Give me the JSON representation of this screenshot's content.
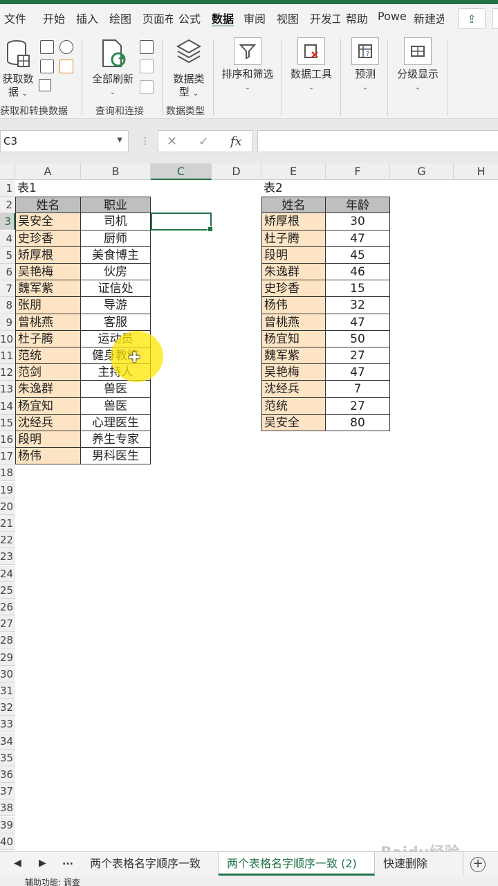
{
  "ribbon_tabs": [
    {
      "label": "文件",
      "active": false
    },
    {
      "label": "开始",
      "active": false
    },
    {
      "label": "插入",
      "active": false
    },
    {
      "label": "绘图",
      "active": false
    },
    {
      "label": "页面布",
      "active": false
    },
    {
      "label": "公式",
      "active": false
    },
    {
      "label": "数据",
      "active": true
    },
    {
      "label": "审阅",
      "active": false
    },
    {
      "label": "视图",
      "active": false
    },
    {
      "label": "开发工",
      "active": false
    },
    {
      "label": "帮助",
      "active": false
    },
    {
      "label": "Powe",
      "active": false
    },
    {
      "label": "新建选",
      "active": false
    }
  ],
  "ribbon": {
    "get_data": {
      "line1": "获取数",
      "line2": "据"
    },
    "refresh_all": "全部刷新",
    "data_types": {
      "line1": "数据类",
      "line2": "型"
    },
    "sort_filter": "排序和筛选",
    "data_tools": "数据工具",
    "forecast": "预测",
    "outline": "分级显示",
    "groups": {
      "get_transform": "获取和转换数据",
      "queries": "查询和连接",
      "data_types": "数据类型"
    }
  },
  "formula_bar": {
    "name_box": "C3",
    "cancel": "✕",
    "confirm": "✓",
    "fx": "fx",
    "value": ""
  },
  "columns": [
    "A",
    "B",
    "C",
    "D",
    "E",
    "F",
    "G",
    "H"
  ],
  "selected_column": "C",
  "selected_row": 3,
  "row_numbers": [
    "1",
    "2",
    "3",
    "4",
    "5",
    "6",
    "7",
    "8",
    "9",
    "10",
    "11",
    "12",
    "13",
    "14",
    "15",
    "16",
    "17",
    "18",
    "19",
    "20",
    "21",
    "22",
    "23",
    "24",
    "25",
    "26",
    "27",
    "28",
    "29",
    "30",
    "31",
    "32",
    "33",
    "34",
    "35",
    "36",
    "37",
    "38",
    "39",
    "40"
  ],
  "table1": {
    "title": "表1",
    "headers": [
      "姓名",
      "职业"
    ],
    "rows": [
      [
        "吴安全",
        "司机"
      ],
      [
        "史珍香",
        "厨师"
      ],
      [
        "矫厚根",
        "美食博主"
      ],
      [
        "吴艳梅",
        "伙房"
      ],
      [
        "魏军紫",
        "证信处"
      ],
      [
        "张朋",
        "导游"
      ],
      [
        "曾桃燕",
        "客服"
      ],
      [
        "杜子腾",
        "运动员"
      ],
      [
        "范统",
        "健身教练"
      ],
      [
        "范剑",
        "主持人"
      ],
      [
        "朱逸群",
        "兽医"
      ],
      [
        "杨宜知",
        "兽医"
      ],
      [
        "沈经兵",
        "心理医生"
      ],
      [
        "段明",
        "养生专家"
      ],
      [
        "杨伟",
        "男科医生"
      ]
    ]
  },
  "table2": {
    "title": "表2",
    "headers": [
      "姓名",
      "年龄"
    ],
    "rows": [
      [
        "矫厚根",
        "30"
      ],
      [
        "杜子腾",
        "47"
      ],
      [
        "段明",
        "45"
      ],
      [
        "朱逸群",
        "46"
      ],
      [
        "史珍香",
        "15"
      ],
      [
        "杨伟",
        "32"
      ],
      [
        "曾桃燕",
        "47"
      ],
      [
        "杨宜知",
        "50"
      ],
      [
        "魏军紫",
        "27"
      ],
      [
        "吴艳梅",
        "47"
      ],
      [
        "沈经兵",
        "7"
      ],
      [
        "范统",
        "27"
      ],
      [
        "吴安全",
        "80"
      ]
    ]
  },
  "sheet_tabs": [
    {
      "label": "两个表格名字顺序一致",
      "active": false
    },
    {
      "label": "两个表格名字顺序一致 (2)",
      "active": true
    },
    {
      "label": "快速删除",
      "active": false
    }
  ],
  "sheet_nav": {
    "prev": "◀",
    "next": "▶",
    "more": "..."
  },
  "status": {
    "accessibility": "辅助功能: 调查"
  },
  "watermark": "Baidu经验"
}
